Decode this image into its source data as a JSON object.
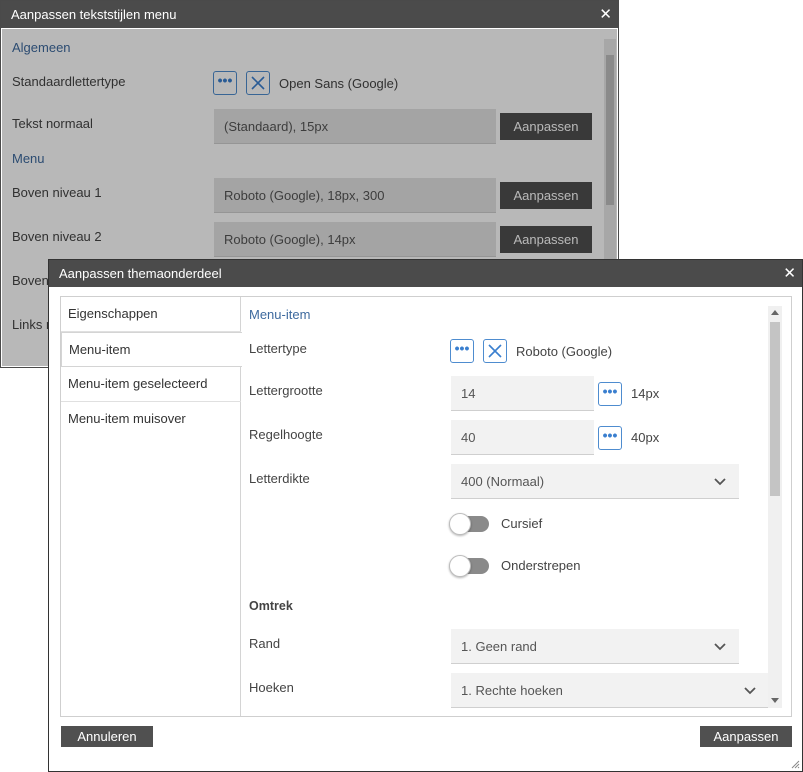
{
  "back_dialog": {
    "title": "Aanpassen tekststijlen menu",
    "close": "✕",
    "sections": {
      "general": "Algemeen",
      "menu": "Menu"
    },
    "rows": {
      "default_font_label": "Standaardlettertype",
      "default_font_value": "Open Sans (Google)",
      "normal_text_label": "Tekst normaal",
      "normal_text_value": "(Standaard), 15px",
      "top_level1_label": "Boven niveau 1",
      "top_level1_value": "Roboto (Google), 18px, 300",
      "top_level2_label": "Boven niveau 2",
      "top_level2_value": "Roboto (Google), 14px",
      "partial_label_3": "Boven",
      "partial_label_4": "Links n"
    },
    "adjust_label": "Aanpassen"
  },
  "front_dialog": {
    "title": "Aanpassen themaonderdeel",
    "close": "✕",
    "nav": [
      "Eigenschappen",
      "Menu-item",
      "Menu-item geselecteerd",
      "Menu-item muisover"
    ],
    "selected_nav_index": 1,
    "section_title": "Menu-item",
    "font": {
      "label": "Lettertype",
      "value": "Roboto (Google)"
    },
    "font_size": {
      "label": "Lettergrootte",
      "input": "14",
      "display": "14px"
    },
    "line_height": {
      "label": "Regelhoogte",
      "input": "40",
      "display": "40px"
    },
    "font_weight": {
      "label": "Letterdikte",
      "value": "400 (Normaal)"
    },
    "italic": {
      "label": "Cursief",
      "on": false
    },
    "underline": {
      "label": "Onderstrepen",
      "on": false
    },
    "outline_header": "Omtrek",
    "border": {
      "label": "Rand",
      "value": "1. Geen rand"
    },
    "corners": {
      "label": "Hoeken",
      "value": "1. Rechte hoeken"
    },
    "cancel_label": "Annuleren",
    "apply_label": "Aanpassen"
  },
  "icons": {
    "more": "more-dots-icon",
    "clear": "clear-x-icon",
    "dropdown": "chevron-down-icon"
  },
  "colors": {
    "titlebar": "#4b4b4b",
    "accent": "#3e6a9e",
    "icon_blue": "#4e8ccf",
    "button": "#505050"
  }
}
